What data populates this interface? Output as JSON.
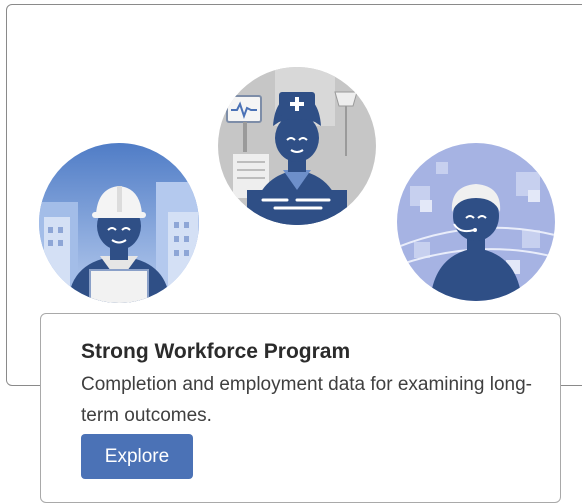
{
  "card": {
    "title": "Strong Workforce Program",
    "description": "Completion and employment data for examining long-term outcomes.",
    "button_label": "Explore"
  },
  "illustrations": [
    {
      "icon": "construction-worker-icon",
      "bg": "#a9c3ea"
    },
    {
      "icon": "nurse-icon",
      "bg": "#c4c4c4"
    },
    {
      "icon": "customer-support-agent-icon",
      "bg": "#a7b4e2"
    }
  ],
  "colors": {
    "accent": "#4b72b6",
    "figure_dark": "#2f4f86",
    "border": "#8a8a8a"
  }
}
